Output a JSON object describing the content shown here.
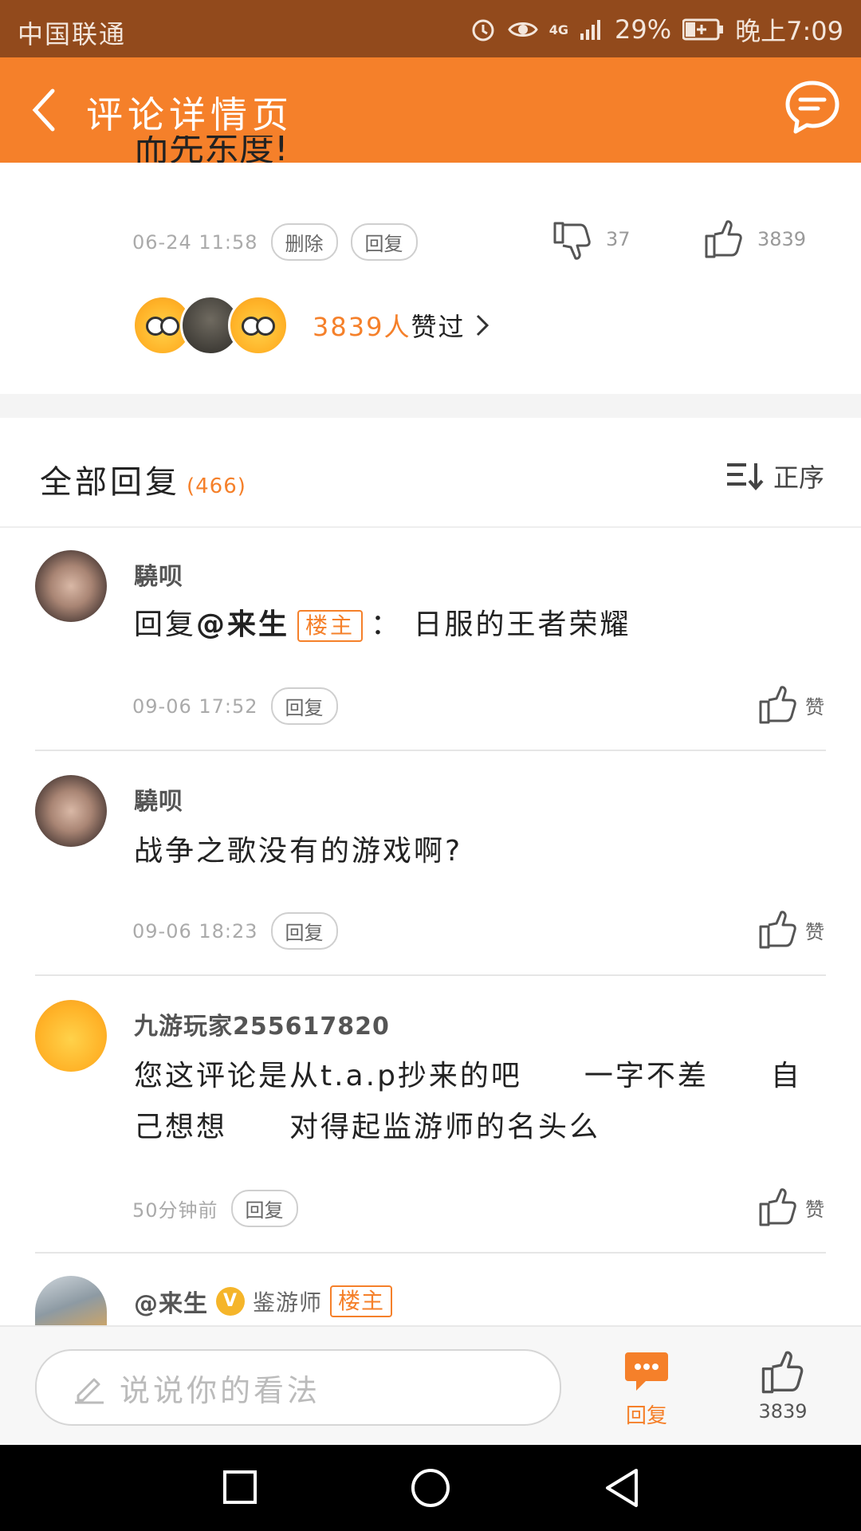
{
  "status_bar": {
    "carrier": "中国联通",
    "network": "4G",
    "battery": "29%",
    "time": "晚上7:09"
  },
  "header": {
    "title": "评论详情页"
  },
  "top_comment": {
    "text_fragment": "而先东度!",
    "time": "06-24 11:58",
    "delete_label": "删除",
    "reply_label": "回复",
    "dislike_count": "37",
    "like_count": "3839",
    "likers_count": "3839人",
    "likers_suffix": "赞过"
  },
  "replies_section": {
    "title": "全部回复",
    "count": "(466)",
    "sort_label": "正序"
  },
  "replies": [
    {
      "username": "驍呗",
      "prefix": "回复",
      "mention": "@来生",
      "owner_badge": "楼主",
      "separator": "：",
      "text": "日服的王者荣耀",
      "time": "09-06 17:52",
      "reply_label": "回复",
      "like_label": "赞"
    },
    {
      "username": "驍呗",
      "text": "战争之歌没有的游戏啊?",
      "time": "09-06 18:23",
      "reply_label": "回复",
      "like_label": "赞"
    },
    {
      "username": "九游玩家255617820",
      "text_line1": "您这评论是从t.a.p抄来的吧　　一字不差　　自",
      "text_line2": "己想想　　对得起监游师的名头么",
      "time": "50分钟前",
      "reply_label": "回复",
      "like_label": "赞"
    },
    {
      "username": "@来生",
      "verified": "V",
      "role": "鉴游师",
      "owner_badge": "楼主"
    }
  ],
  "bottom_bar": {
    "input_placeholder": "说说你的看法",
    "reply_label": "回复",
    "like_count": "3839"
  },
  "colors": {
    "accent": "#f5802a",
    "status_bar": "#924a1c"
  }
}
